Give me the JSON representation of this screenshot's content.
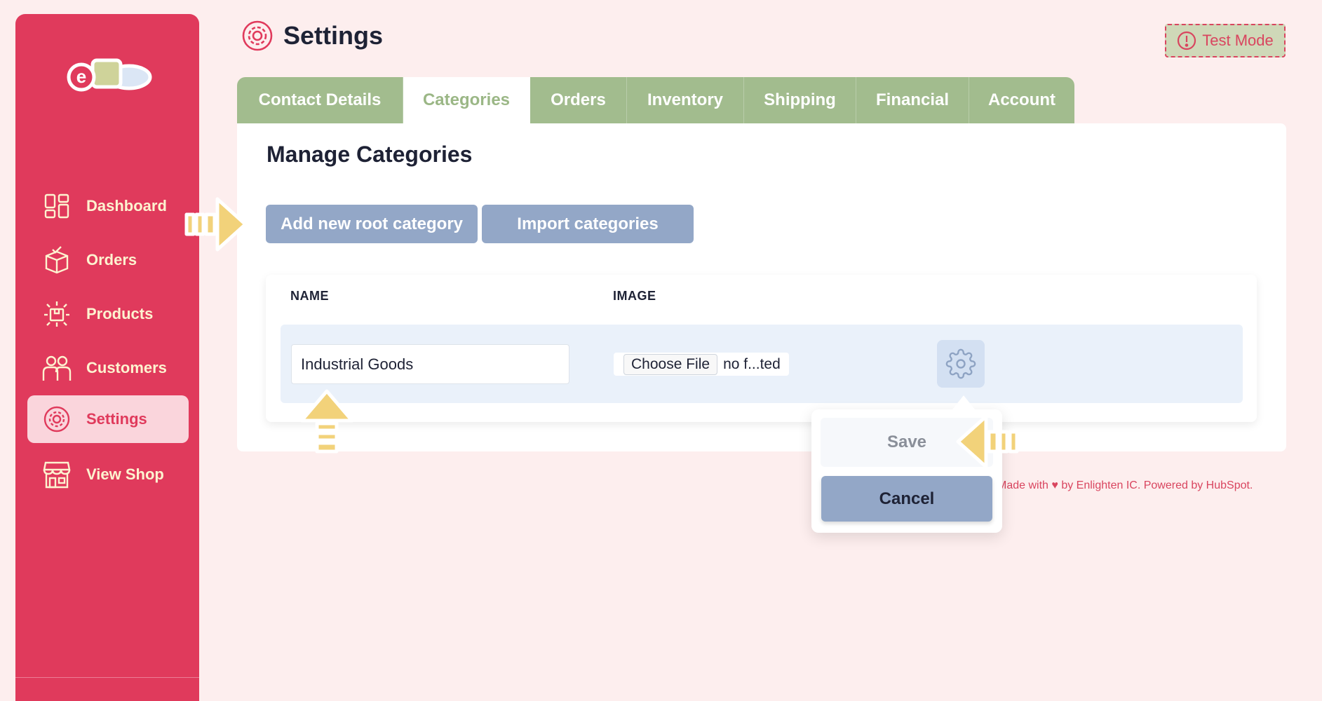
{
  "app": {
    "logo_text": "eZo",
    "page_title": "Settings",
    "test_mode_label": "Test Mode"
  },
  "sidebar": {
    "items": [
      {
        "label": "Dashboard",
        "icon": "dashboard-icon",
        "active": false
      },
      {
        "label": "Orders",
        "icon": "orders-box-icon",
        "active": false
      },
      {
        "label": "Products",
        "icon": "products-icon",
        "active": false
      },
      {
        "label": "Customers",
        "icon": "customers-icon",
        "active": false
      },
      {
        "label": "Settings",
        "icon": "settings-icon",
        "active": true
      },
      {
        "label": "View Shop",
        "icon": "shop-icon",
        "active": false
      }
    ]
  },
  "tabs": [
    {
      "label": "Contact Details",
      "active": false
    },
    {
      "label": "Categories",
      "active": true
    },
    {
      "label": "Orders",
      "active": false
    },
    {
      "label": "Inventory",
      "active": false
    },
    {
      "label": "Shipping",
      "active": false
    },
    {
      "label": "Financial",
      "active": false
    },
    {
      "label": "Account",
      "active": false
    }
  ],
  "main": {
    "section_title": "Manage Categories",
    "add_root_label": "Add new root category",
    "import_label": "Import categories",
    "table": {
      "columns": [
        "NAME",
        "IMAGE"
      ],
      "rows": [
        {
          "name_value": "Industrial Goods",
          "choose_file_label": "Choose File",
          "file_status": "no f...ted"
        }
      ]
    },
    "popover": {
      "save_label": "Save",
      "cancel_label": "Cancel"
    }
  },
  "footer": {
    "prefix": "Made with",
    "suffix": "by Enlighten IC. Powered by HubSpot."
  },
  "colors": {
    "sidebar": "#e03a5c",
    "background": "#fdeeee",
    "tab_green": "#a2bc8e",
    "button_blue": "#93a7c7",
    "accent_red": "#d9455f",
    "hint_arrow_yellow": "#f2d27a"
  }
}
